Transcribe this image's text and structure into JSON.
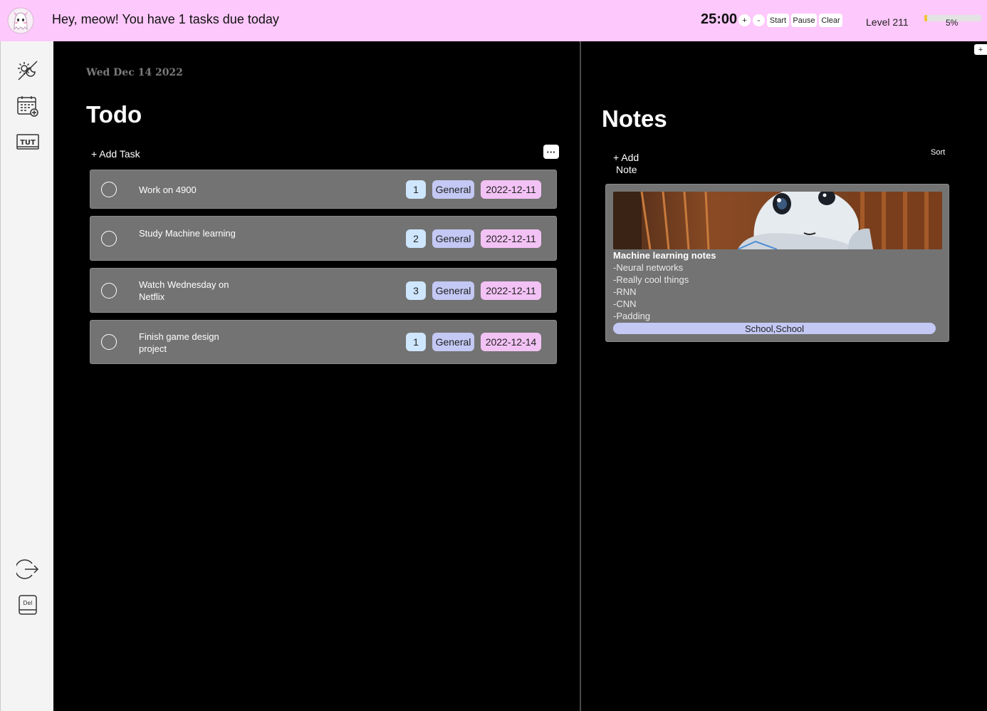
{
  "header": {
    "greeting": "Hey, meow! You have 1 tasks due today",
    "timer": "25:00",
    "timer_plus": "+",
    "timer_minus": "-",
    "start_label": "Start",
    "pause_label": "Pause",
    "clear_label": "Clear",
    "level_label": "Level 211",
    "xp_percent_label": "5%",
    "xp_progress": 0.05,
    "bg_color": "#fdc8fb"
  },
  "sidebar": {
    "icons": [
      "theme-toggle-icon",
      "calendar-add-icon",
      "tutorial-icon",
      "logout-icon",
      "delete-icon"
    ]
  },
  "todo": {
    "date": "Wed Dec 14 2022",
    "title": "Todo",
    "add_task_label": "+ Add Task",
    "more_label": "···",
    "tasks": [
      {
        "name": "Work on 4900",
        "priority": "1",
        "category": "General",
        "due": "2022-12-11"
      },
      {
        "name": "Study Machine learning",
        "priority": "2",
        "category": "General",
        "due": "2022-12-11"
      },
      {
        "name": "Watch Wednesday on Netflix",
        "priority": "3",
        "category": "General",
        "due": "2022-12-11"
      },
      {
        "name": "Finish game design project",
        "priority": "1",
        "category": "General",
        "due": "2022-12-14"
      }
    ]
  },
  "notes": {
    "title": "Notes",
    "add_note_line1": "+ Add",
    "add_note_line2": "Note",
    "sort_label": "Sort",
    "plus_tab": "+",
    "cards": [
      {
        "title": "Machine learning notes",
        "lines": [
          "-Neural networks",
          "-Really cool things",
          "-RNN",
          "-CNN",
          "-Padding"
        ],
        "tags": "School,School"
      }
    ]
  }
}
